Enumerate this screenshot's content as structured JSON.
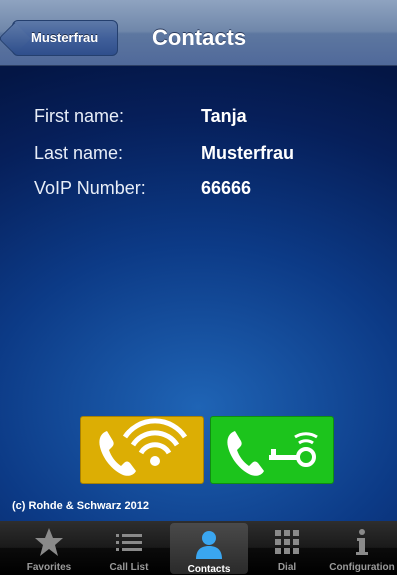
{
  "navbar": {
    "back_label": "Musterfrau",
    "title": "Contacts"
  },
  "contact": {
    "fields": [
      {
        "label": "First name:",
        "value": "Tanja"
      },
      {
        "label": "Last name:",
        "value": "Musterfrau"
      },
      {
        "label": "VoIP Number:",
        "value": "66666"
      }
    ]
  },
  "actions": {
    "wlan_call_icon": "phone-wifi-icon",
    "key_call_icon": "phone-key-icon",
    "wlan_color": "#dcae04",
    "key_color": "#1cc41c"
  },
  "copyright": "(c) Rohde & Schwarz 2012",
  "tabbar": {
    "tabs": [
      {
        "label": "Favorites",
        "icon": "star-icon"
      },
      {
        "label": "Call List",
        "icon": "list-icon"
      },
      {
        "label": "Contacts",
        "icon": "person-icon",
        "active": true
      },
      {
        "label": "Dial",
        "icon": "keypad-icon"
      },
      {
        "label": "Configuration",
        "icon": "info-icon"
      }
    ]
  }
}
